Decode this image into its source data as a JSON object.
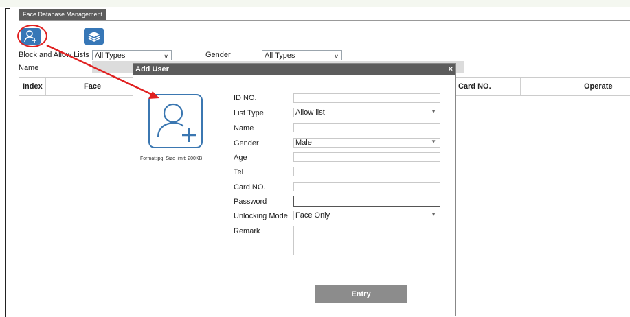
{
  "tab": {
    "label": "Face Database Management"
  },
  "toolbar": {
    "block_allow_label": "Block and Allow Lists",
    "block_allow_value": "All Types",
    "gender_label": "Gender",
    "gender_value": "All Types",
    "name_label": "Name"
  },
  "table": {
    "headers": {
      "index": "Index",
      "face": "Face",
      "card_no": "Card NO.",
      "operate": "Operate"
    }
  },
  "dialog": {
    "title": "Add User",
    "close": "×",
    "format_note": "Format:jpg, Size limit: 200KB",
    "fields": {
      "id_no": {
        "label": "ID NO.",
        "value": ""
      },
      "list_type": {
        "label": "List Type",
        "value": "Allow list"
      },
      "name": {
        "label": "Name",
        "value": ""
      },
      "gender": {
        "label": "Gender",
        "value": "Male"
      },
      "age": {
        "label": "Age",
        "value": ""
      },
      "tel": {
        "label": "Tel",
        "value": ""
      },
      "card_no": {
        "label": "Card NO.",
        "value": ""
      },
      "password": {
        "label": "Password",
        "value": ""
      },
      "unlocking_mode": {
        "label": "Unlocking Mode",
        "value": "Face Only"
      },
      "remark": {
        "label": "Remark",
        "value": ""
      }
    },
    "entry_label": "Entry"
  },
  "colors": {
    "accent": "#3777b7",
    "annotation": "#e02020",
    "dialog_title_bg": "#5c5c5c"
  }
}
